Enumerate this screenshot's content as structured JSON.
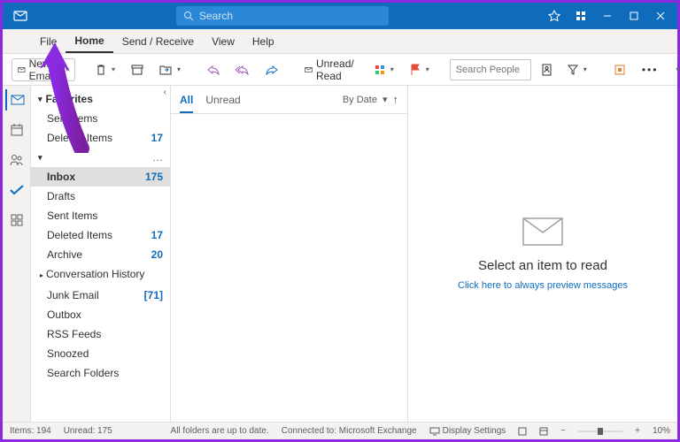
{
  "titlebar": {
    "search_placeholder": "Search"
  },
  "menu": {
    "rail_gap": "",
    "tabs": [
      "File",
      "Home",
      "Send / Receive",
      "View",
      "Help"
    ],
    "active": 1
  },
  "ribbon": {
    "new_email": "New Email",
    "unread_read": "Unread/ Read",
    "search_people_placeholder": "Search People"
  },
  "folders": {
    "favorites_label": "Favorites",
    "favorites": [
      {
        "name": "Sent Items",
        "count": null
      },
      {
        "name": "Deleted Items",
        "count": "17"
      }
    ],
    "account": [
      {
        "name": "Inbox",
        "count": "175",
        "sel": true
      },
      {
        "name": "Drafts",
        "count": null
      },
      {
        "name": "Sent Items",
        "count": null
      },
      {
        "name": "Deleted Items",
        "count": "17"
      },
      {
        "name": "Archive",
        "count": "20"
      },
      {
        "name": "Conversation History",
        "count": null,
        "expand": true
      },
      {
        "name": "Junk Email",
        "count": "71",
        "brk": true
      },
      {
        "name": "Outbox",
        "count": null
      },
      {
        "name": "RSS Feeds",
        "count": null
      },
      {
        "name": "Snoozed",
        "count": null
      },
      {
        "name": "Search Folders",
        "count": null
      }
    ]
  },
  "msglist": {
    "tabs": [
      "All",
      "Unread"
    ],
    "sort": "By Date"
  },
  "reading": {
    "title": "Select an item to read",
    "link": "Click here to always preview messages"
  },
  "status": {
    "items": "Items: 194",
    "unread": "Unread: 175",
    "upd": "All folders are up to date.",
    "conn": "Connected to: Microsoft Exchange",
    "disp": "Display Settings",
    "zoom": "10%"
  }
}
